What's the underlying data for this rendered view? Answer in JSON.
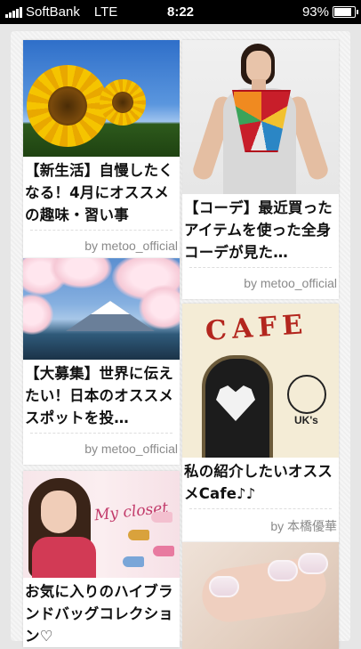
{
  "status_bar": {
    "carrier": "SoftBank",
    "network": "LTE",
    "time": "8:22",
    "battery": "93%",
    "battery_level": 0.93
  },
  "feed": {
    "cards": [
      {
        "title": "【新生活】自慢したくなる！4月にオススメの趣味・習い事",
        "author": "by metoo_official"
      },
      {
        "title": "【コーデ】最近買ったアイテムを使った全身コーデが見た…",
        "author": "by metoo_official"
      },
      {
        "title": "【大募集】世界に伝えたい！日本のオススメスポットを投…",
        "author": "by metoo_official"
      },
      {
        "title": "私の紹介したいオススメCafe♪♪",
        "author": "by 本橋優華"
      },
      {
        "title": "お気に入りのハイブランドバッグコレクション♡",
        "author": ""
      },
      {
        "title": "",
        "author": ""
      }
    ]
  },
  "images": {
    "cafe_sign": "CAFE",
    "cafe_logo": "UK's",
    "closet_text": "My closet"
  }
}
